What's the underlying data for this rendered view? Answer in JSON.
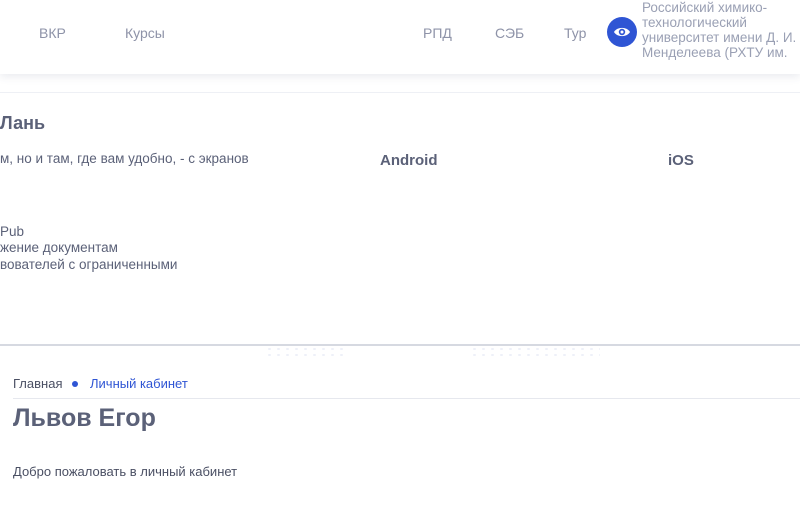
{
  "nav": {
    "items": [
      "ВКР",
      "Курсы",
      "РПД",
      "СЭБ",
      "Тур"
    ],
    "icon": "eye-icon",
    "org_name": "Российский химико-технологический университет имени Д. И. Менделеева (РХТУ им. Д. И. Менделеева)"
  },
  "library": {
    "title": "Лань",
    "line_screens": "м, но и там, где вам удобно, - с экранов",
    "platform_android": "Android",
    "platform_ios": "iOS",
    "line_pub": "Pub",
    "line_docs": "жение документам",
    "line_users": "вователей с ограниченными"
  },
  "breadcrumb": {
    "home": "Главная",
    "current": "Личный кабинет"
  },
  "profile": {
    "name": "Львов Егор",
    "welcome": "Добро пожаловать в личный кабинет"
  },
  "colors": {
    "accent": "#2f55d4",
    "text": "#5b6178",
    "muted": "#8e93a8"
  }
}
